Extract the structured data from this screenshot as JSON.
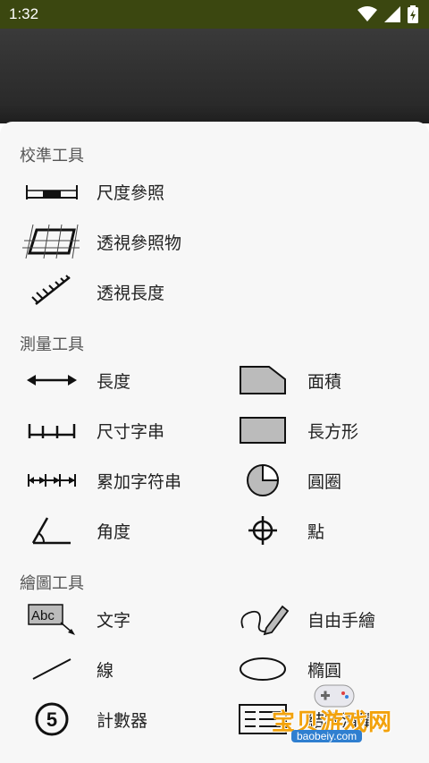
{
  "status_bar": {
    "time": "1:32"
  },
  "sections": {
    "calibration": {
      "title": "校準工具",
      "items": [
        {
          "label": "尺度參照",
          "icon": "scale-ruler-icon"
        },
        {
          "label": "透視參照物",
          "icon": "perspective-grid-icon"
        },
        {
          "label": "透視長度",
          "icon": "perspective-ruler-icon"
        }
      ]
    },
    "measure": {
      "title": "測量工具",
      "items": [
        {
          "label": "長度",
          "icon": "length-arrow-icon"
        },
        {
          "label": "面積",
          "icon": "area-polygon-icon"
        },
        {
          "label": "尺寸字串",
          "icon": "dimension-string-icon"
        },
        {
          "label": "長方形",
          "icon": "rectangle-icon"
        },
        {
          "label": "累加字符串",
          "icon": "cumulative-dimension-icon"
        },
        {
          "label": "圓圈",
          "icon": "circle-sector-icon"
        },
        {
          "label": "角度",
          "icon": "angle-icon"
        },
        {
          "label": "點",
          "icon": "crosshair-point-icon"
        }
      ]
    },
    "drawing": {
      "title": "繪圖工具",
      "items": [
        {
          "label": "文字",
          "icon": "text-box-icon"
        },
        {
          "label": "自由手繪",
          "icon": "freehand-pencil-icon"
        },
        {
          "label": "線",
          "icon": "line-icon"
        },
        {
          "label": "橢圓",
          "icon": "ellipse-icon"
        },
        {
          "label": "計數器",
          "icon": "counter-five-icon"
        },
        {
          "label": "結構清單",
          "icon": "list-table-icon"
        }
      ]
    }
  },
  "watermark": {
    "text": "宝贝游戏网",
    "url": "baobeiy.com"
  },
  "colors": {
    "status_bar": "#3b4710",
    "sheet": "#f7f7f7",
    "shape_fill": "#bbbbbb"
  }
}
